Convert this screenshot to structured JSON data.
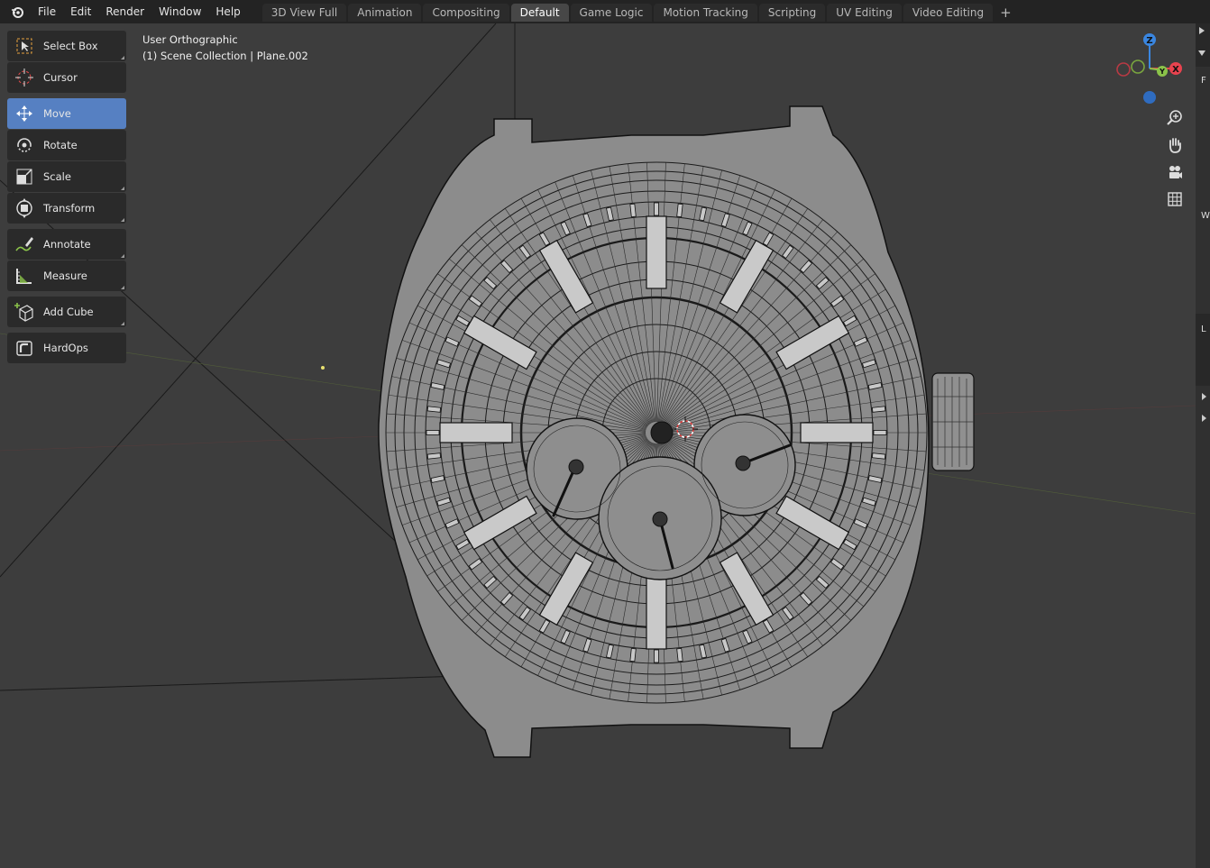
{
  "menu": {
    "file": "File",
    "edit": "Edit",
    "render": "Render",
    "window": "Window",
    "help": "Help"
  },
  "workspace_tabs": [
    {
      "label": "3D View Full"
    },
    {
      "label": "Animation"
    },
    {
      "label": "Compositing"
    },
    {
      "label": "Default"
    },
    {
      "label": "Game Logic"
    },
    {
      "label": "Motion Tracking"
    },
    {
      "label": "Scripting"
    },
    {
      "label": "UV Editing"
    },
    {
      "label": "Video Editing"
    }
  ],
  "active_tab": "Default",
  "add_tab_label": "+",
  "viewport": {
    "view_name": "User Orthographic",
    "collection": "(1) Scene Collection | Plane.002"
  },
  "tools": [
    {
      "label": "Select Box",
      "icon": "select-box-icon",
      "active": false
    },
    {
      "label": "Cursor",
      "icon": "cursor-icon",
      "active": false
    },
    {
      "label": "Move",
      "icon": "move-icon",
      "active": true
    },
    {
      "label": "Rotate",
      "icon": "rotate-icon",
      "active": false
    },
    {
      "label": "Scale",
      "icon": "scale-icon",
      "active": false
    },
    {
      "label": "Transform",
      "icon": "transform-icon",
      "active": false
    },
    {
      "label": "Annotate",
      "icon": "annotate-icon",
      "active": false
    },
    {
      "label": "Measure",
      "icon": "measure-icon",
      "active": false
    },
    {
      "label": "Add Cube",
      "icon": "add-cube-icon",
      "active": false
    },
    {
      "label": "HardOps",
      "icon": "hardops-icon",
      "active": false
    }
  ],
  "gizmo": {
    "z": "Z",
    "y": "Y",
    "x": "X"
  },
  "right_strip": {
    "f": "F",
    "w": "W",
    "l": "L"
  },
  "colors": {
    "active_tool": "#5680c2",
    "axis_x": "#e8434f",
    "axis_y": "#8bc34a",
    "axis_z": "#3a86e0"
  }
}
